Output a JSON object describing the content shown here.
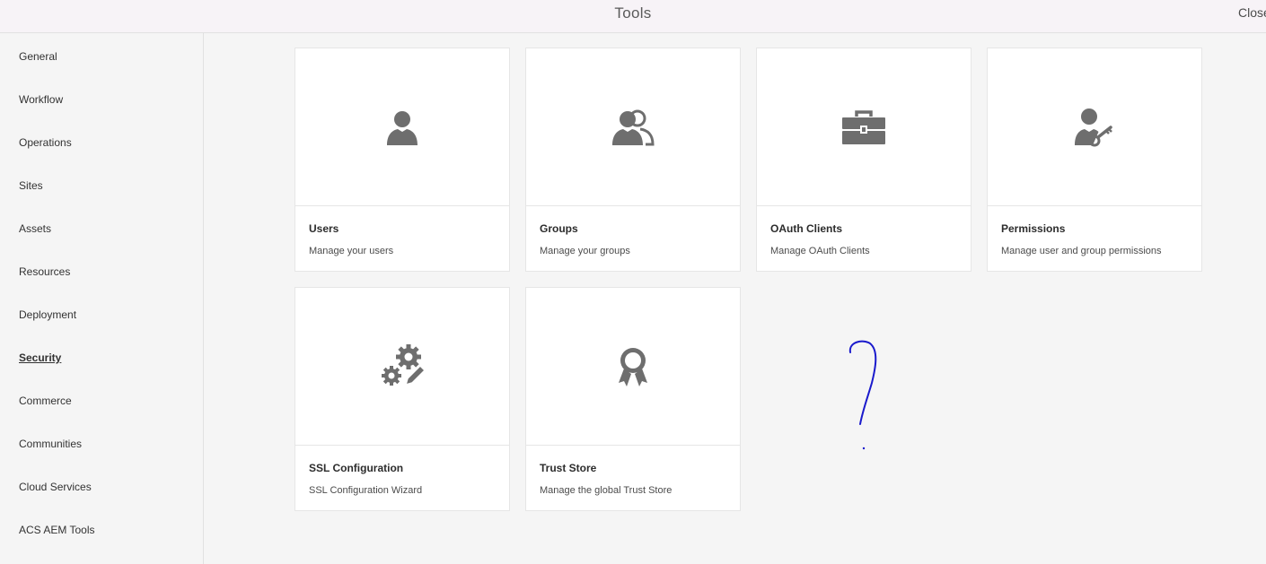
{
  "header": {
    "title": "Tools",
    "close_label": "Close"
  },
  "sidebar": {
    "active_index": 7,
    "items": [
      {
        "label": "General"
      },
      {
        "label": "Workflow"
      },
      {
        "label": "Operations"
      },
      {
        "label": "Sites"
      },
      {
        "label": "Assets"
      },
      {
        "label": "Resources"
      },
      {
        "label": "Deployment"
      },
      {
        "label": "Security"
      },
      {
        "label": "Commerce"
      },
      {
        "label": "Communities"
      },
      {
        "label": "Cloud Services"
      },
      {
        "label": "ACS AEM Tools"
      }
    ]
  },
  "cards": [
    {
      "title": "Users",
      "description": "Manage your users",
      "icon": "user-icon"
    },
    {
      "title": "Groups",
      "description": "Manage your groups",
      "icon": "users-group-icon"
    },
    {
      "title": "OAuth Clients",
      "description": "Manage OAuth Clients",
      "icon": "briefcase-icon"
    },
    {
      "title": "Permissions",
      "description": "Manage user and group permissions",
      "icon": "user-key-icon"
    },
    {
      "title": "SSL Configuration",
      "description": "SSL Configuration Wizard",
      "icon": "gears-pencil-icon"
    },
    {
      "title": "Trust Store",
      "description": "Manage the global Trust Store",
      "icon": "award-ribbon-icon"
    }
  ],
  "colors": {
    "icon": "#6e6e6e",
    "annotation": "#1a1acc",
    "header_bg": "#f7f3f7",
    "page_bg": "#f5f5f5"
  }
}
